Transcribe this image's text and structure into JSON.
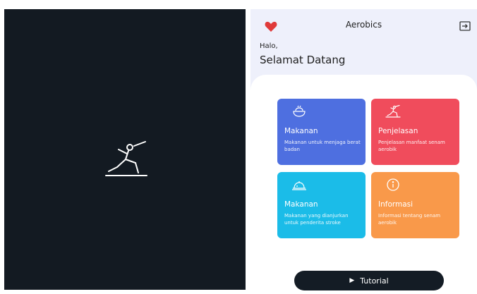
{
  "splash": {
    "logo_icon": "aerobics-pose-icon",
    "background": "#131a22"
  },
  "header": {
    "title": "Aerobics",
    "heart_icon": "heart-icon",
    "logout_icon": "logout-icon"
  },
  "greeting": {
    "hello": "Halo,",
    "welcome": "Selamat Datang"
  },
  "cards": [
    {
      "title": "Makanan",
      "description": "Makanan untuk menjaga berat badan",
      "icon": "food-bowl-icon",
      "color": "#4e6fe0"
    },
    {
      "title": "Penjelasan",
      "description": "Penjelasan manfaat senam aerobik",
      "icon": "aerobics-pose-icon",
      "color": "#f04c5c"
    },
    {
      "title": "Makanan",
      "description": "Makanan yang dianjurkan untuk penderita stroke",
      "icon": "food-tray-icon",
      "color": "#1bbce8"
    },
    {
      "title": "Informasi",
      "description": "Informasi tentang senam aerobik",
      "icon": "info-icon",
      "color": "#f9994a"
    }
  ],
  "tutorial_button": {
    "label": "Tutorial",
    "icon": "play-icon"
  }
}
